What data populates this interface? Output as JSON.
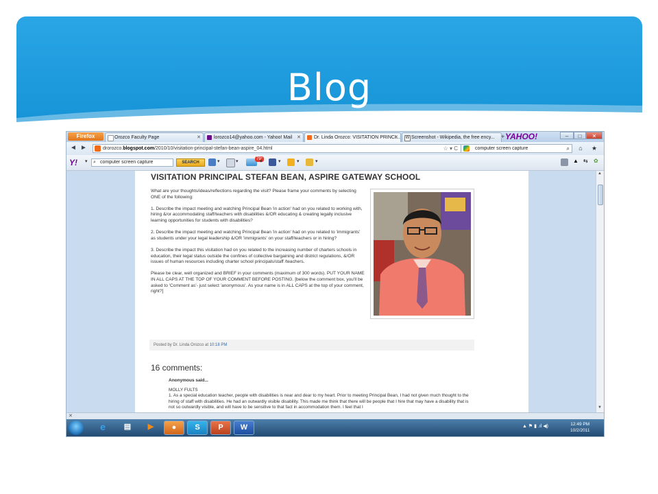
{
  "slide": {
    "title": "Blog"
  },
  "browser": {
    "menu_button": "Firefox",
    "tabs": [
      {
        "label": "Orozco Faculty Page",
        "icon": "page-icon",
        "color": "#ffffff"
      },
      {
        "label": "lorozco14@yahoo.com - Yahoo! Mail",
        "icon": "yahoo-mail-icon",
        "color": "#6b0a8b"
      },
      {
        "label": "Dr. Linda Orozco: VISITATION PRINCI...",
        "icon": "blogger-icon",
        "color": "#f06a1a",
        "active": true
      },
      {
        "label": "Screenshot - Wikipedia, the free ency...",
        "icon": "wikipedia-icon",
        "color": "#ffffff"
      }
    ],
    "new_tab": "+",
    "tabbar_logo": "YAHOO!",
    "window_controls": {
      "minimize": "–",
      "maximize": "□",
      "close": "✕"
    },
    "back": "◄",
    "forward": "►",
    "url_prefix": "drorozco.",
    "url_domain": "blogspot.com",
    "url_path": "/2010/10/visitation-principal-stefan-bean-aspire_04.html",
    "url_star": "☆ ▾ C",
    "search_value": "computer screen capture",
    "search_icon": "⌕",
    "home_icon": "⌂",
    "bookmark_icon": "★"
  },
  "yahoo_toolbar": {
    "logo": "Y!",
    "search_value": "computer screen capture",
    "search_button": "SEARCH",
    "weather_badge": "79°"
  },
  "post": {
    "title": "VISITATION PRINCIPAL STEFAN BEAN, ASPIRE GATEWAY SCHOOL",
    "intro": "What are your thoughts/ideas/reflections regarding the visit? Please frame your comments by selecting ONE of the following:",
    "q1": "1. Describe the impact meeting and watching Principal Bean 'in action' had on you related to working with, hiring &/or accommodating staff/teachers with disabilities &/OR educating & creating legally inclusive learning opportunities for students with disabilities?",
    "q2": "2. Describe the impact meeting and watching Principal Bean 'in action' had on you related to 'immigrants' as students under your legal leadership &/OR 'immigrants' on your staff/teachers or in hiring?",
    "q3": "3. Describe the impact this visitation had on you related to the increasing number of charters schools in education, their legal status outside the confines of collective bargaining and district regulations, &/OR issues of human resources including charter school principals/staff /teachers.",
    "closing": "Please be clear, well organized and BRIEF in your comments (maximum of 300 words). PUT YOUR NAME IN ALL CAPS AT THE TOP OF YOUR COMMENT BEFORE POSTING. [below the comment box, you'll be asked to 'Comment as'- just select 'anonymous'. As your name is in ALL CAPS at the top of your comment, right?]",
    "posted_by_label": "Posted by Dr. Linda Orozco at",
    "posted_time": "10:18 PM"
  },
  "comments": {
    "heading": "16 comments:",
    "first": {
      "author": "Anonymous said...",
      "name": "MOLLY FULTS",
      "text": "1. As a special education teacher, people with disabilities is near and dear to my heart. Prior to meeting Principal Bean, I had not given much thought to the hiring of staff with disabilities. He had an outwardly visible disability. This made me think that there will be people that I hire that may have a disability that is not so outwardly visible, and will have to be sensitive to that fact in accommodation them. I feel that I"
    }
  },
  "statusbar": {
    "text": "✕"
  },
  "taskbar": {
    "tray_icons": "▲  ⚑  ▮  .ıl  ◀)",
    "time": "12:49 PM",
    "date": "10/2/2011"
  }
}
